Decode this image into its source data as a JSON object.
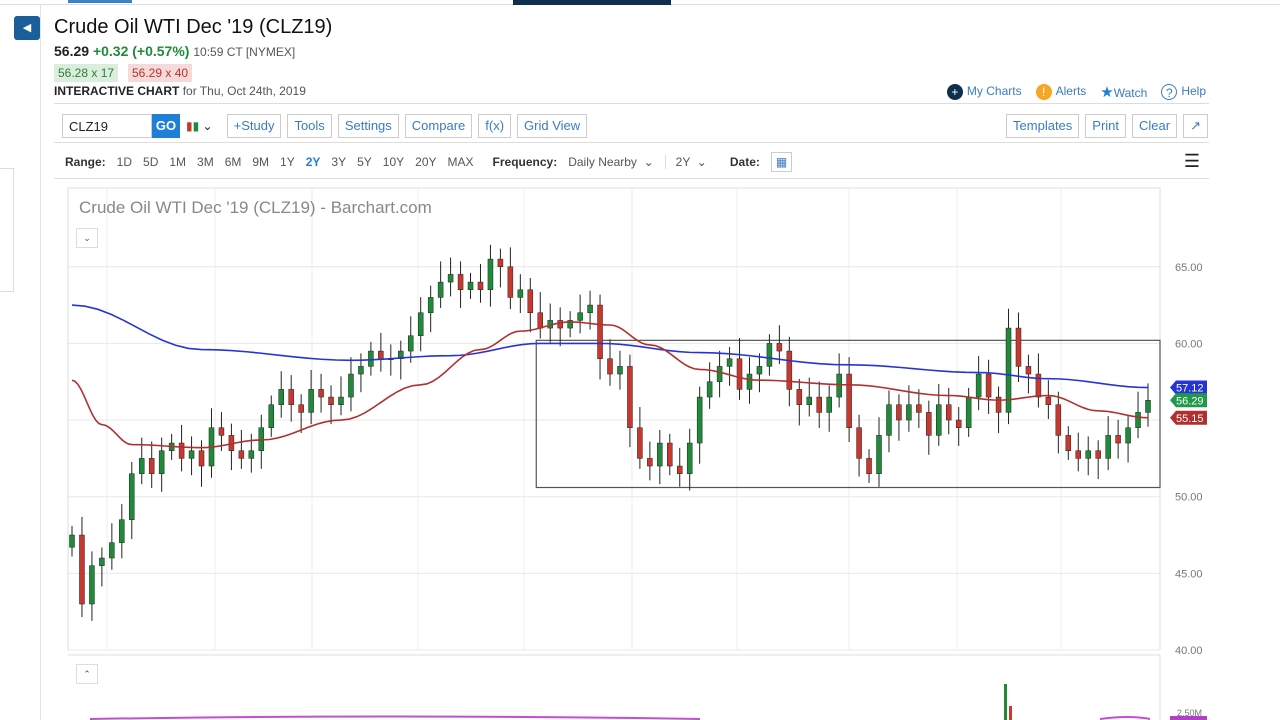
{
  "header": {
    "title": "Crude Oil WTI Dec '19 (CLZ19)",
    "last": "56.29",
    "change": "+0.32 (+0.57%)",
    "time": "10:59 CT [NYMEX]",
    "bid": "56.28 x 17",
    "ask": "56.29 x 40",
    "chart_label": "INTERACTIVE CHART",
    "chart_date": "for Thu, Oct 24th, 2019",
    "links": [
      "My Charts",
      "Alerts",
      "Watch",
      "Help"
    ]
  },
  "toolbar": {
    "symbol": "CLZ19",
    "go": "GO",
    "buttons": [
      "+Study",
      "Tools",
      "Settings",
      "Compare",
      "f(x)",
      "Grid View"
    ],
    "right_buttons": [
      "Templates",
      "Print",
      "Clear",
      "↗"
    ]
  },
  "range": {
    "label": "Range:",
    "options": [
      "1D",
      "5D",
      "1M",
      "3M",
      "6M",
      "9M",
      "1Y",
      "2Y",
      "3Y",
      "5Y",
      "10Y",
      "20Y",
      "MAX"
    ],
    "selected": "2Y",
    "frequency_label": "Frequency:",
    "frequency": "Daily Nearby",
    "period": "2Y",
    "date_label": "Date:"
  },
  "chart_data": {
    "type": "candlestick",
    "title": "Crude Oil WTI Dec '19 (CLZ19) - Barchart.com",
    "ylim": [
      40,
      67
    ],
    "yticks": [
      "65.00",
      "60.00",
      "50.00",
      "45.00",
      "40.00"
    ],
    "ytick_values": [
      65,
      60,
      50,
      45,
      40
    ],
    "closes": [
      47.5,
      43.0,
      45.5,
      46.0,
      47.0,
      48.5,
      51.5,
      52.5,
      51.5,
      53.0,
      53.5,
      52.5,
      53.0,
      52.0,
      54.5,
      54.0,
      53.0,
      52.5,
      53.0,
      54.5,
      56.0,
      57.0,
      56.0,
      55.5,
      57.0,
      56.5,
      56.0,
      56.5,
      58.0,
      58.5,
      59.5,
      59.0,
      59.0,
      59.5,
      60.5,
      62.0,
      63.0,
      64.0,
      64.5,
      63.5,
      64.0,
      63.5,
      65.5,
      65.0,
      63.0,
      63.5,
      62.0,
      61.0,
      61.5,
      61.0,
      61.5,
      62.0,
      62.5,
      59.0,
      58.0,
      58.5,
      54.5,
      52.5,
      52.0,
      53.5,
      52.0,
      51.5,
      53.5,
      56.5,
      57.5,
      58.5,
      59.0,
      57.0,
      58.0,
      58.5,
      60.0,
      59.5,
      57.0,
      56.0,
      56.5,
      55.5,
      56.5,
      58.0,
      54.5,
      52.5,
      51.5,
      54.0,
      56.0,
      55.0,
      56.0,
      55.5,
      54.0,
      56.0,
      55.0,
      54.5,
      56.5,
      58.0,
      56.5,
      55.5,
      61.0,
      58.5,
      58.0,
      56.5,
      56.0,
      54.0,
      53.0,
      52.5,
      53.0,
      52.5,
      54.0,
      53.5,
      54.5,
      55.5,
      56.29
    ],
    "ma_long": {
      "color": "#2634d6",
      "label": "57.12",
      "points": [
        [
          0,
          62.5
        ],
        [
          13,
          59.6
        ],
        [
          28,
          58.9
        ],
        [
          38,
          59.2
        ],
        [
          47,
          60.0
        ],
        [
          53,
          60.0
        ],
        [
          63,
          59.4
        ],
        [
          78,
          58.6
        ],
        [
          91,
          58.1
        ],
        [
          98,
          57.7
        ],
        [
          108,
          57.12
        ]
      ]
    },
    "ma_short": {
      "color": "#b0302f",
      "label": "55.15",
      "points": [
        [
          0,
          57.6
        ],
        [
          3,
          54.7
        ],
        [
          6,
          53.4
        ],
        [
          13,
          53.2
        ],
        [
          19,
          53.7
        ],
        [
          27,
          55.0
        ],
        [
          35,
          57.3
        ],
        [
          41,
          59.6
        ],
        [
          45,
          60.8
        ],
        [
          50,
          61.4
        ],
        [
          54,
          61.2
        ],
        [
          58,
          59.9
        ],
        [
          63,
          58.3
        ],
        [
          69,
          57.6
        ],
        [
          78,
          57.3
        ],
        [
          88,
          56.6
        ],
        [
          93,
          56.3
        ],
        [
          98,
          56.6
        ],
        [
          103,
          55.6
        ],
        [
          108,
          55.15
        ]
      ]
    },
    "last_label": {
      "value": "56.29",
      "color": "#1f9a4a"
    },
    "up_color": "#1f8a3a",
    "down_color": "#c8382f",
    "range_box": {
      "from_index": 47,
      "to_index": 110,
      "high": 60.2,
      "low": 50.6
    },
    "volume_ticks": [
      "2.50M"
    ]
  }
}
